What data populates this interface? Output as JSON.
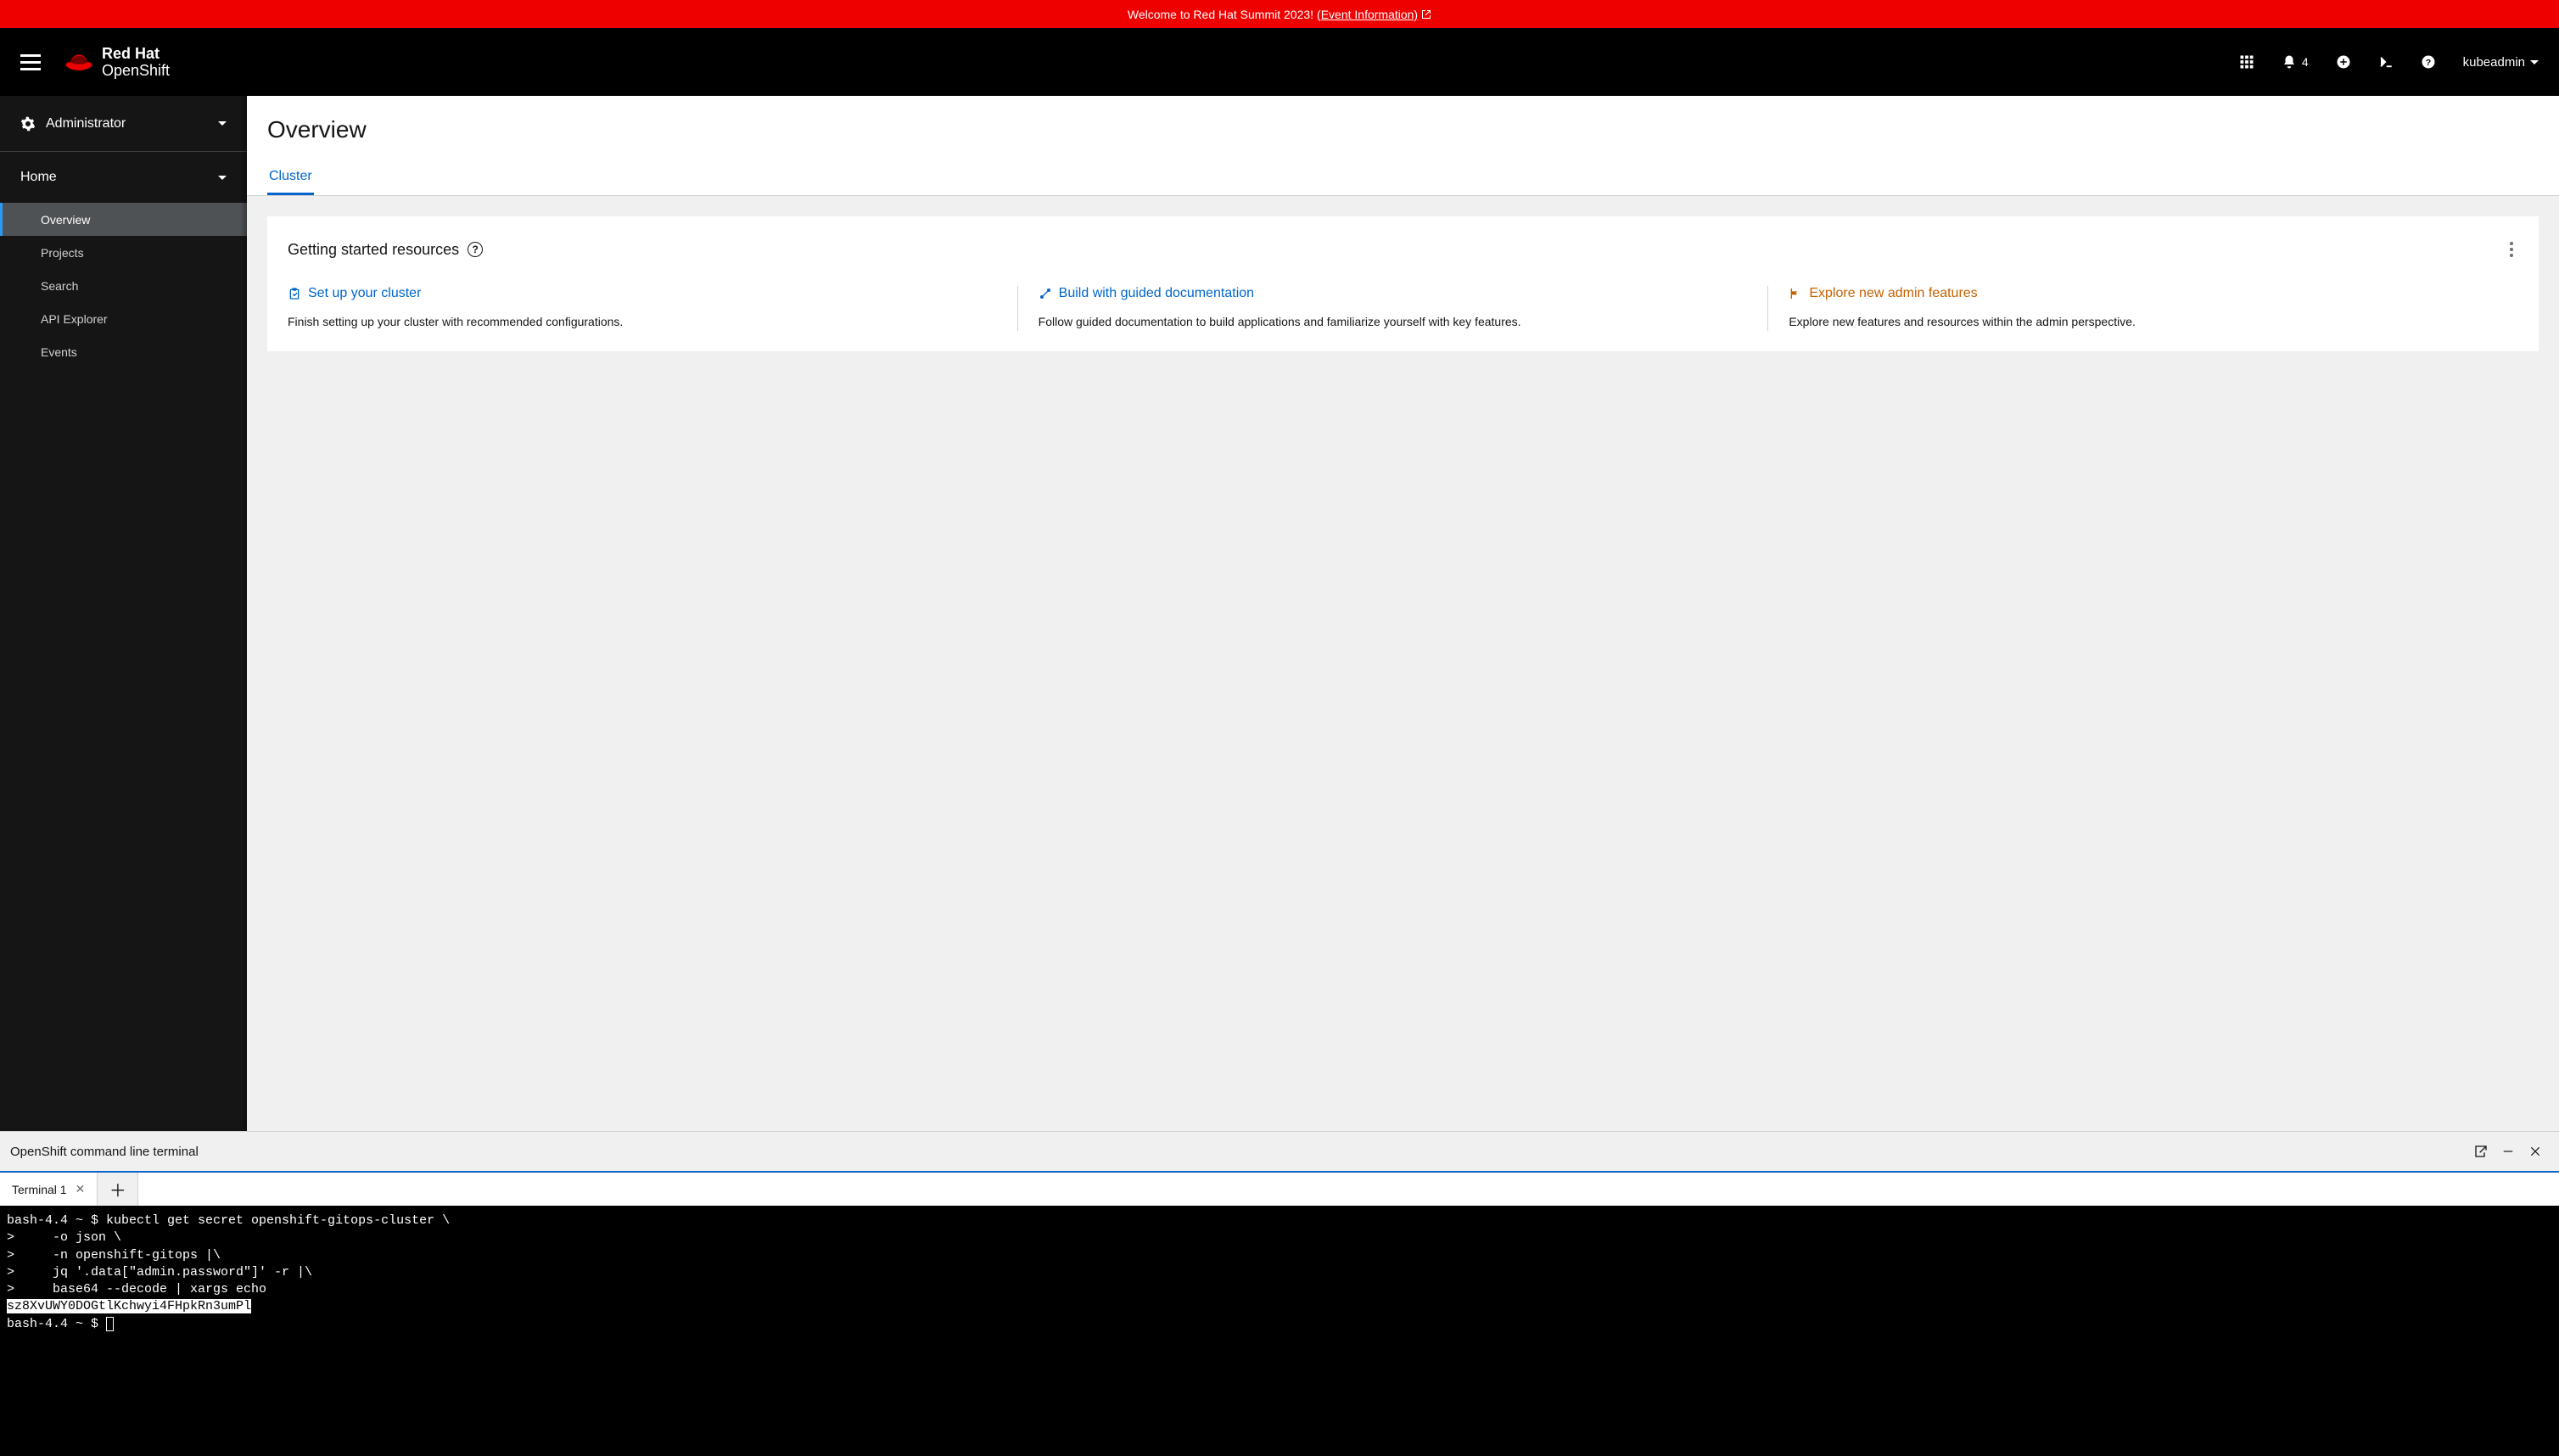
{
  "banner": {
    "text": "Welcome to Red Hat Summit 2023!",
    "link_text": "(Event Information)"
  },
  "brand": {
    "line1": "Red Hat",
    "line2": "OpenShift"
  },
  "masthead": {
    "notification_count": "4",
    "user": "kubeadmin"
  },
  "sidebar": {
    "perspective": "Administrator",
    "section": "Home",
    "items": [
      {
        "label": "Overview",
        "active": true
      },
      {
        "label": "Projects",
        "active": false
      },
      {
        "label": "Search",
        "active": false
      },
      {
        "label": "API Explorer",
        "active": false
      },
      {
        "label": "Events",
        "active": false
      }
    ]
  },
  "page": {
    "title": "Overview",
    "tab": "Cluster"
  },
  "getting_started": {
    "title": "Getting started resources",
    "columns": [
      {
        "icon": "clipboard",
        "color": "blue",
        "title": "Set up your cluster",
        "desc": "Finish setting up your cluster with recommended configurations."
      },
      {
        "icon": "route",
        "color": "blue",
        "title": "Build with guided documentation",
        "desc": "Follow guided documentation to build applications and familiarize yourself with key features."
      },
      {
        "icon": "flag",
        "color": "orange",
        "title": "Explore new admin features",
        "desc": "Explore new features and resources within the admin perspective."
      }
    ]
  },
  "terminal": {
    "title": "OpenShift command line terminal",
    "tab_label": "Terminal 1",
    "lines": [
      {
        "t": "plain",
        "text": "bash-4.4 ~ $ kubectl get secret openshift-gitops-cluster \\"
      },
      {
        "t": "plain",
        "text": ">     -o json \\"
      },
      {
        "t": "plain",
        "text": ">     -n openshift-gitops |\\"
      },
      {
        "t": "plain",
        "text": ">     jq '.data[\"admin.password\"]' -r |\\"
      },
      {
        "t": "plain",
        "text": ">     base64 --decode | xargs echo"
      },
      {
        "t": "hl",
        "text": "sz8XvUWY0DOGtlKchwyi4FHpkRn3umPl"
      },
      {
        "t": "prompt",
        "text": "bash-4.4 ~ $ "
      }
    ]
  }
}
